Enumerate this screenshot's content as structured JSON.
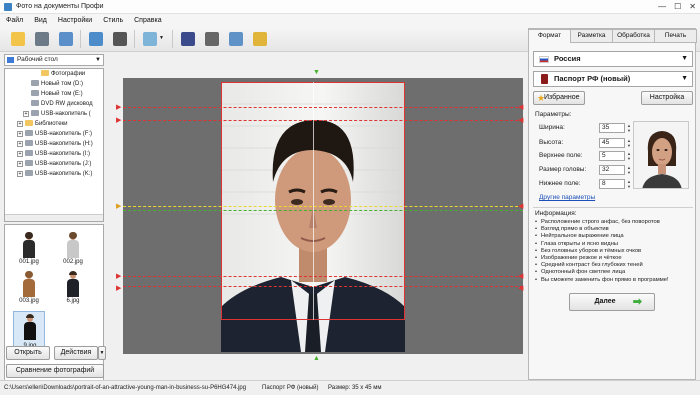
{
  "window": {
    "title": "Фото на документы Профи",
    "controls": [
      "—",
      "☐",
      "✕"
    ]
  },
  "menu": [
    "Файл",
    "Вид",
    "Настройки",
    "Стиль",
    "Справка"
  ],
  "left": {
    "drive": "Рабочий стол",
    "tree": [
      {
        "label": "Фотографии",
        "indent": 3,
        "type": "folder"
      },
      {
        "label": "Новый том (D:)",
        "indent": 2,
        "type": "drive"
      },
      {
        "label": "Новый том (E:)",
        "indent": 2,
        "type": "drive"
      },
      {
        "label": "DVD RW дисковод",
        "indent": 2,
        "type": "drive"
      },
      {
        "label": "USB-накопитель (",
        "indent": 2,
        "type": "drive"
      },
      {
        "label": "Библиотеки",
        "indent": 1,
        "type": "folder"
      },
      {
        "label": "USB-накопитель (F:)",
        "indent": 1,
        "type": "drive"
      },
      {
        "label": "USB-накопитель (H:)",
        "indent": 1,
        "type": "drive"
      },
      {
        "label": "USB-накопитель (I:)",
        "indent": 1,
        "type": "drive"
      },
      {
        "label": "USB-накопитель (J:)",
        "indent": 1,
        "type": "drive"
      },
      {
        "label": "USB-накопитель (K:)",
        "indent": 1,
        "type": "drive"
      }
    ],
    "thumbs": [
      "001.jpg",
      "002.jpg",
      "003.jpg",
      "6.jpg",
      "9.jpg"
    ],
    "open_btn": "Открыть",
    "actions_btn": "Действия",
    "compare_btn": "Сравнение фотографий"
  },
  "right": {
    "tabs": [
      "Формат",
      "Разметка",
      "Обработка",
      "Печать"
    ],
    "country": "Россия",
    "doc_type": "Паспорт РФ (новый)",
    "favorites_btn": "Избранное",
    "settings_btn": "Настройка",
    "params_title": "Параметры:",
    "params": [
      {
        "label": "Ширина:",
        "value": "35"
      },
      {
        "label": "Высота:",
        "value": "45"
      },
      {
        "label": "Верхнее поле:",
        "value": "5"
      },
      {
        "label": "Размер головы:",
        "value": "32"
      },
      {
        "label": "Нижнее поле:",
        "value": "8"
      }
    ],
    "other_params": "Другие параметры",
    "info_title": "Информация:",
    "info": [
      "Расположение строго анфас, без поворотов",
      "Взгляд прямо в объектив",
      "Нейтральное выражение лица",
      "Глаза открыты и ясно видны",
      "Без головных уборов и тёмных очков",
      "Изображение резкое и чёткое",
      "Средний контраст без глубоких теней",
      "Однотонный фон светлее лица",
      "Вы сможете заменить фон прямо в программе!"
    ],
    "next_btn": "Далее"
  },
  "status": {
    "path": "C:\\Users\\ellen\\Downloads\\portrait-of-an-attractive-young-man-in-business-su-P6HG474.jpg",
    "doc": "Паспорт РФ (новый)",
    "size": "Размер: 35 x 45 мм"
  },
  "colors": {
    "accent": "#d33333",
    "guide_yellow": "#e8d830",
    "guide_green": "#47b02c",
    "arrow_green": "#3fae3f"
  }
}
